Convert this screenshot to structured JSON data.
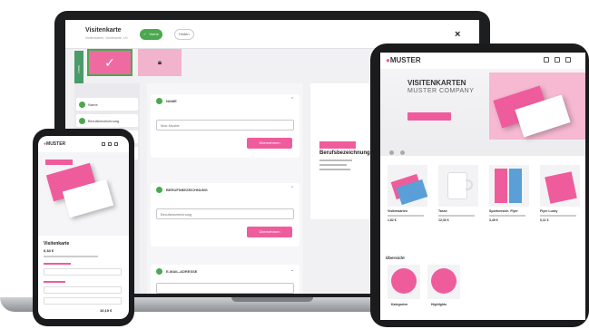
{
  "laptop": {
    "editor": {
      "title": "Visitenkarte",
      "subtitle": "Visitenkarten, Vorderseite, 1/0",
      "tab_front": "Vorne",
      "tab_back": "Hinten",
      "side_tab": "Seiten",
      "close": "×",
      "sidebar": [
        {
          "label": "Name"
        },
        {
          "label": "Berufsbezeichnung"
        }
      ],
      "sections": [
        {
          "label": "NAME",
          "input_value": "Max Muster",
          "button": "Übernehmen"
        },
        {
          "label": "BERUFSBEZEICHNUNG",
          "input_value": "Berufsbezeichnung",
          "button": "Übernehmen"
        },
        {
          "label": "E-MAIL-ADRESSE"
        }
      ],
      "preview_title": "Berufsbezeichnung"
    }
  },
  "tablet": {
    "logo": "MUSTER",
    "hero_title": "VISITENKARTEN",
    "hero_subtitle": "MUSTER COMPANY",
    "products": [
      {
        "name": "Visitenkarten",
        "price": "1,82 €"
      },
      {
        "name": "Tasse",
        "price": "12,33 €"
      },
      {
        "name": "Sportversich. Flyer",
        "price": "3,49 €"
      },
      {
        "name": "Flyer Lucky",
        "price": "0,11 €"
      }
    ],
    "section_title": "Übersicht",
    "categories": [
      {
        "label": "Kategorien"
      },
      {
        "label": "Highlights"
      }
    ]
  },
  "phone": {
    "logo": "MUSTER",
    "product_title": "Visitenkarte",
    "price": "0,34 €",
    "total": "10,19 €"
  },
  "colors": {
    "accent_pink": "#ef5c9c",
    "confirm_green": "#4ca84f",
    "device_frame": "#1b1b1d"
  }
}
